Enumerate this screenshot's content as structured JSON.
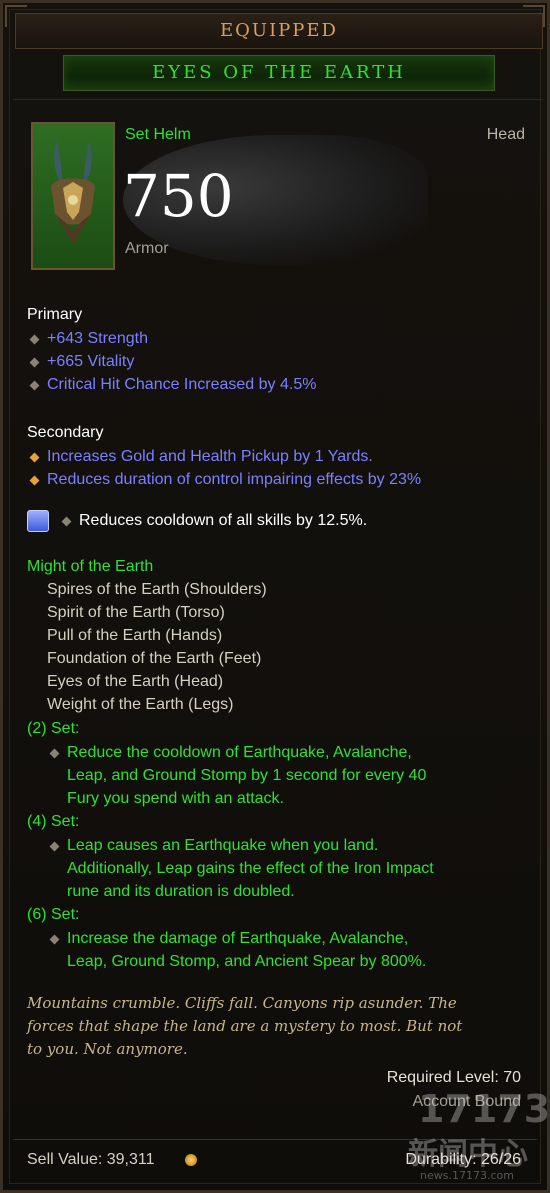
{
  "header": {
    "equipped": "EQUIPPED",
    "item_name": "EYES OF THE EARTH"
  },
  "item": {
    "slot_type": "Set Helm",
    "slot": "Head",
    "armor_value": "750",
    "armor_label": "Armor",
    "icon": "helm-icon"
  },
  "primary": {
    "label": "Primary",
    "stats": [
      "+643 Strength",
      "+665 Vitality",
      "Critical Hit Chance Increased by 4.5%"
    ]
  },
  "secondary": {
    "label": "Secondary",
    "stats": [
      "Increases Gold and Health Pickup by 1 Yards.",
      "Reduces duration of control impairing effects by 23%"
    ]
  },
  "socket": {
    "text": "Reduces cooldown of all skills by 12.5%.",
    "icon": "gem-icon"
  },
  "set": {
    "name": "Might of the Earth",
    "pieces": [
      "Spires of the Earth (Shoulders)",
      "Spirit of the Earth (Torso)",
      "Pull of the Earth (Hands)",
      "Foundation of the Earth (Feet)",
      "Eyes of the Earth (Head)",
      "Weight of the Earth (Legs)"
    ],
    "bonuses": [
      {
        "label": "(2) Set:",
        "lines": [
          "Reduce the cooldown of Earthquake, Avalanche,",
          "Leap, and Ground Stomp by 1 second for every 40",
          "Fury you spend with an attack."
        ]
      },
      {
        "label": "(4) Set:",
        "lines": [
          "Leap causes an Earthquake when you land.",
          "Additionally, Leap gains the effect of the Iron Impact",
          "rune and its duration is doubled."
        ]
      },
      {
        "label": "(6) Set:",
        "lines": [
          "Increase the damage of Earthquake, Avalanche,",
          "Leap, Ground Stomp, and Ancient Spear by 800%."
        ]
      }
    ]
  },
  "lore": [
    "Mountains crumble. Cliffs fall. Canyons rip asunder. The",
    "forces that shape the land are a mystery to most. But not",
    "to you. Not anymore."
  ],
  "requirements": {
    "level": "Required Level: 70",
    "binding": "Account Bound"
  },
  "footer": {
    "sell_value": "Sell Value: 39,311",
    "durability": "Durability: 26/26"
  },
  "watermark": {
    "line1": "17173",
    "line2": "新闻中心",
    "url": "news.17173.com"
  },
  "colors": {
    "set_green": "#2fe22f",
    "magic_blue": "#7a80ff",
    "title_orange": "#d8a060"
  }
}
